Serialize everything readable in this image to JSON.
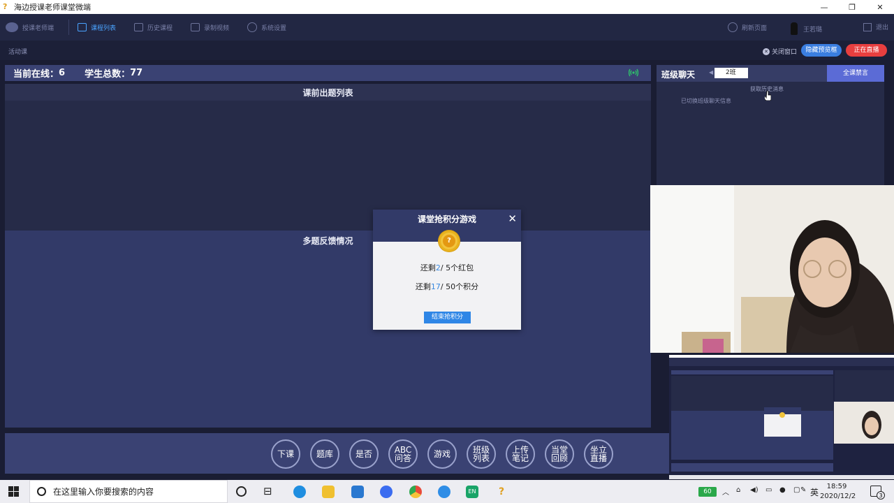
{
  "window": {
    "title": "海边授课老师课堂微端",
    "controls": [
      "—",
      "❐",
      "✕"
    ]
  },
  "nav": {
    "app_name": "授课老师端",
    "items": [
      {
        "label": "课程列表",
        "active": true
      },
      {
        "label": "历史课程",
        "active": false
      },
      {
        "label": "录制视频",
        "active": false
      },
      {
        "label": "系统设置",
        "active": false
      }
    ],
    "refresh": "刷新页面",
    "user": "王若璐",
    "logout": "退出"
  },
  "subbar": {
    "tag": "活动课",
    "close_window": "关闭窗口",
    "hide_preview": "隐藏预览框",
    "live": "正在直播"
  },
  "stats": {
    "online_label": "当前在线：",
    "online": "6",
    "total_label": "学生总数：",
    "total": "77"
  },
  "panels": {
    "pre_class": "课前出题列表",
    "feedback": "多题反馈情况"
  },
  "toolbar": {
    "buttons": [
      "下课",
      "题库",
      "是否",
      "ABC\n问答",
      "游戏",
      "班级\n列表",
      "上传\n笔记",
      "当堂\n回顾",
      "坐立\n直播"
    ]
  },
  "chat": {
    "title": "班级聊天",
    "class_select": "2班",
    "mute_all": "全课禁言",
    "history": "获取历史消息",
    "system_msg": "已切换班级聊天信息"
  },
  "dialog": {
    "title": "课堂抢积分游戏",
    "line1_pre": "还剩",
    "line1_num": "2",
    "line1_post": "/ 5个红包",
    "line2_pre": "还剩",
    "line2_num": "17",
    "line2_post": "/ 50个积分",
    "end_button": "结束抢积分"
  },
  "taskbar": {
    "search_placeholder": "在这里输入你要搜索的内容",
    "battery": "60",
    "ime": "英",
    "time": "18:59",
    "date": "2020/12/2",
    "notifications": "3"
  },
  "colors": {
    "accent": "#4aa3ff",
    "live_red": "#e83f3f",
    "panel": "#3a4273"
  }
}
